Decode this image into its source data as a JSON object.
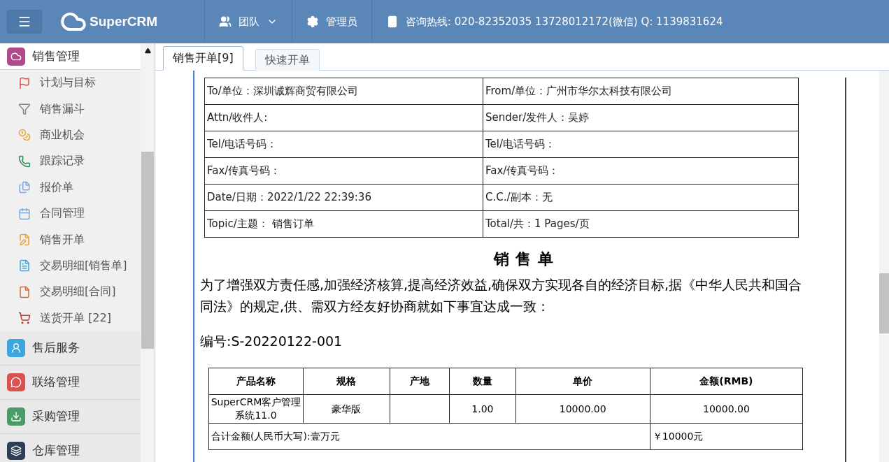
{
  "header": {
    "logo": "SuperCRM",
    "nav": [
      {
        "kind": "team",
        "label": "团队"
      },
      {
        "kind": "admin",
        "label": "管理员"
      },
      {
        "kind": "phone",
        "label": "咨询热线: 020-82352035 13728012172(微信) Q: 1139831624"
      }
    ]
  },
  "sidebar": {
    "groups": [
      {
        "label": "销售管理",
        "expanded": true,
        "children": [
          {
            "label": "计划与目标"
          },
          {
            "label": "销售漏斗"
          },
          {
            "label": "商业机会"
          },
          {
            "label": "跟踪记录"
          },
          {
            "label": "报价单"
          },
          {
            "label": "合同管理"
          },
          {
            "label": "销售开单"
          },
          {
            "label": "交易明细[销售单]"
          },
          {
            "label": "交易明细[合同]"
          },
          {
            "label": "送货开单 [22]"
          }
        ]
      },
      {
        "label": "售后服务",
        "expanded": false
      },
      {
        "label": "联络管理",
        "expanded": false
      },
      {
        "label": "采购管理",
        "expanded": false
      },
      {
        "label": "仓库管理",
        "expanded": false
      }
    ]
  },
  "tabs": [
    {
      "label": "销售开单[9]",
      "selected": true
    },
    {
      "label": "快速开单",
      "selected": false
    }
  ],
  "document": {
    "info_rows": [
      [
        "To/单位：深圳诚辉商贸有限公司",
        "From/单位：广州市华尔太科技有限公司"
      ],
      [
        "Attn/收件人:",
        "Sender/发件人：吴婷"
      ],
      [
        "Tel/电话号码：",
        "Tel/电话号码："
      ],
      [
        "Fax/传真号码：",
        "Fax/传真号码："
      ],
      [
        "Date/日期：2022/1/22 22:39:36",
        "C.C./副本：无"
      ],
      [
        "Topic/主题： 销售订单",
        "Total/共：1 Pages/页"
      ]
    ],
    "title": "销 售 单",
    "intro": "为了增强双方责任感,加强经济核算,提高经济效益,确保双方实现各自的经济目标,据《中华人民共和国合同法》的规定,供、需双方经友好协商就如下事宜达成一致：",
    "number": "编号:S-20220122-001",
    "items": {
      "columns": [
        "产品名称",
        "规格",
        "产地",
        "数量",
        "单价",
        "金额(RMB)"
      ],
      "rows": [
        [
          "SuperCRM客户管理系统11.0",
          "豪华版",
          "",
          "1.00",
          "10000.00",
          "10000.00"
        ]
      ],
      "total_label": "合计金额(人民币大写):壹万元",
      "total_value": "￥10000元"
    }
  }
}
